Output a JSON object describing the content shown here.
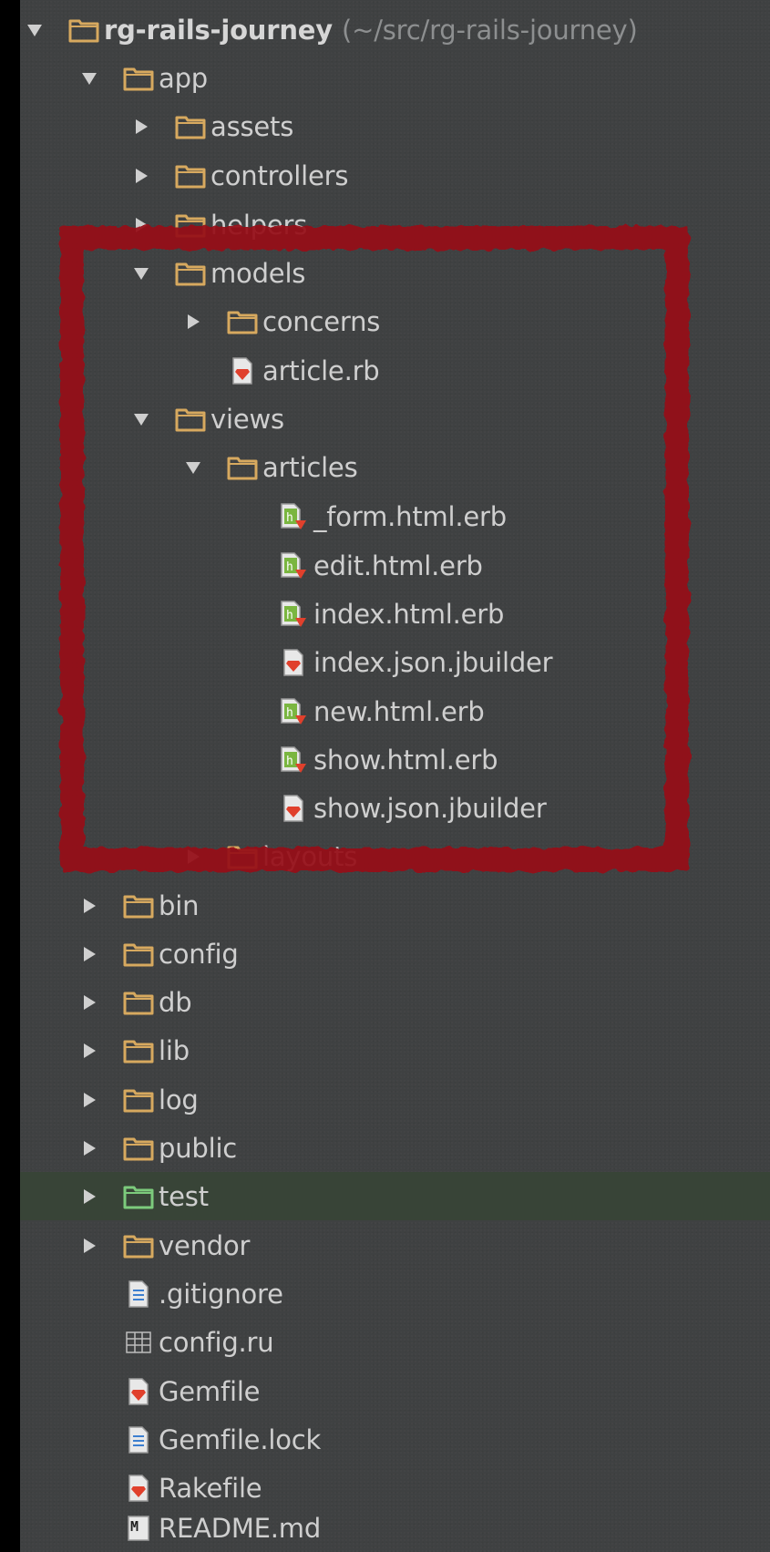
{
  "tree": {
    "root": {
      "label": "rg-rails-journey",
      "path": "(~/src/rg-rails-journey)"
    },
    "items": [
      {
        "label": "app"
      },
      {
        "label": "assets"
      },
      {
        "label": "controllers"
      },
      {
        "label": "helpers"
      },
      {
        "label": "models"
      },
      {
        "label": "concerns"
      },
      {
        "label": "article.rb"
      },
      {
        "label": "views"
      },
      {
        "label": "articles"
      },
      {
        "label": "_form.html.erb"
      },
      {
        "label": "edit.html.erb"
      },
      {
        "label": "index.html.erb"
      },
      {
        "label": "index.json.jbuilder"
      },
      {
        "label": "new.html.erb"
      },
      {
        "label": "show.html.erb"
      },
      {
        "label": "show.json.jbuilder"
      },
      {
        "label": "layouts"
      },
      {
        "label": "bin"
      },
      {
        "label": "config"
      },
      {
        "label": "db"
      },
      {
        "label": "lib"
      },
      {
        "label": "log"
      },
      {
        "label": "public"
      },
      {
        "label": "test"
      },
      {
        "label": "vendor"
      },
      {
        "label": ".gitignore"
      },
      {
        "label": "config.ru"
      },
      {
        "label": "Gemfile"
      },
      {
        "label": "Gemfile.lock"
      },
      {
        "label": "Rakefile"
      },
      {
        "label": "README.md"
      }
    ]
  },
  "colors": {
    "panel_bg": "#3f4142",
    "selected_bg": "#384437",
    "text": "#cfcfcf",
    "path_text": "#8d8f90",
    "folder": "#d7a95f",
    "test_folder": "#7ccb7c",
    "highlight": "#961216"
  },
  "icons": {
    "expanded": "triangle-down-icon",
    "collapsed": "triangle-right-icon",
    "folder": "folder-icon",
    "ruby_file": "ruby-file-icon",
    "erb_file": "erb-file-icon",
    "text_file": "text-file-icon",
    "rack_file": "rack-file-icon",
    "markdown_file": "markdown-file-icon",
    "markdown_badge": "M"
  }
}
